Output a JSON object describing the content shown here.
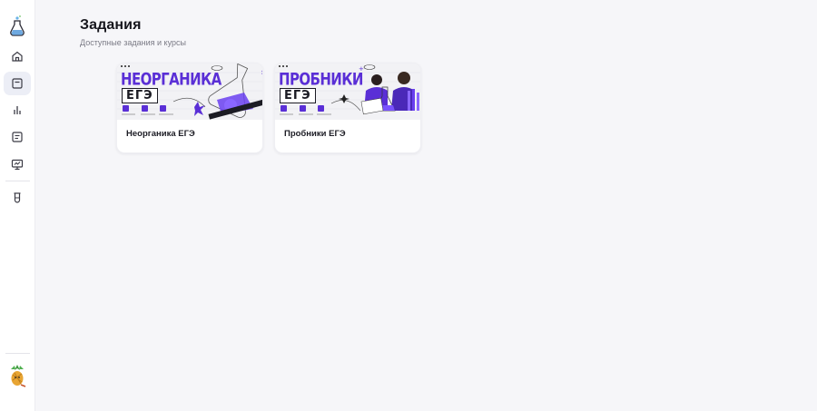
{
  "page": {
    "title": "Задания",
    "subtitle": "Доступные задания и курсы"
  },
  "sidebar": {
    "items": [
      {
        "name": "home",
        "icon": "home-icon",
        "active": false
      },
      {
        "name": "tasks",
        "icon": "tasks-icon",
        "active": true
      },
      {
        "name": "stats",
        "icon": "bar-chart-icon",
        "active": false
      },
      {
        "name": "notes",
        "icon": "document-icon",
        "active": false
      },
      {
        "name": "lessons",
        "icon": "monitor-icon",
        "active": false
      },
      {
        "name": "lab",
        "icon": "test-tube-icon",
        "active": false
      }
    ]
  },
  "cards": [
    {
      "label": "Неорганика ЕГЭ",
      "banner_title": "НЕОРГАНИКА",
      "banner_subtitle": "ЕГЭ"
    },
    {
      "label": "Пробники ЕГЭ",
      "banner_title": "ПРОБНИКИ",
      "banner_subtitle": "ЕГЭ"
    }
  ],
  "colors": {
    "accent": "#5a2fd6",
    "background": "#f6f6f9",
    "sidebar_active": "#eceef6"
  }
}
